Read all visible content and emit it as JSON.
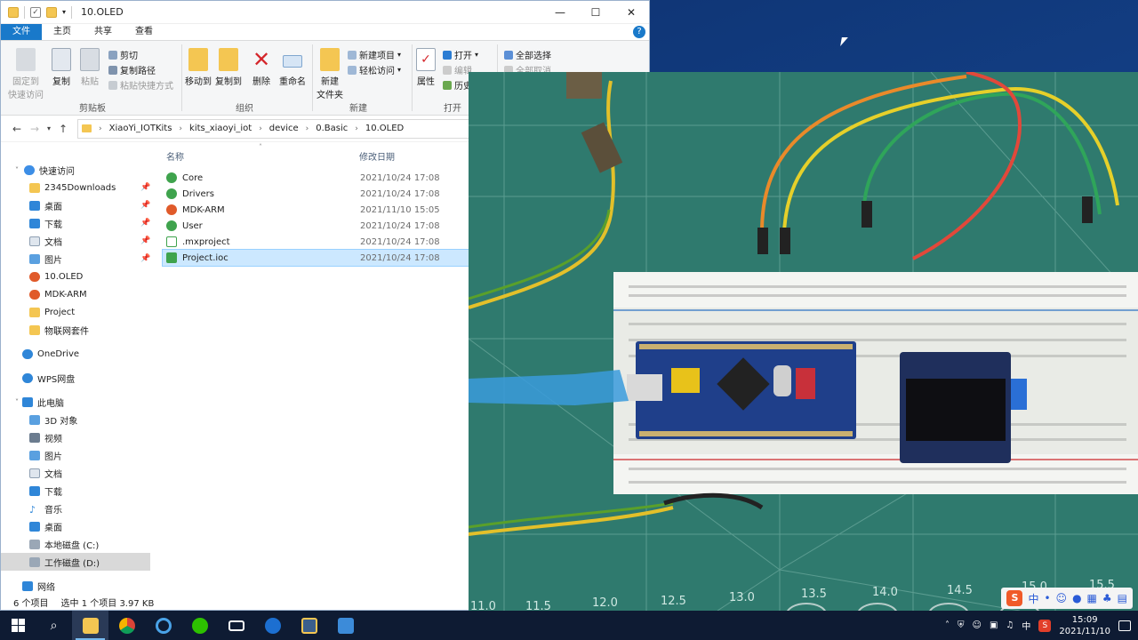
{
  "window": {
    "title": "10.OLED",
    "controls": [
      "—",
      "☐",
      "✕"
    ]
  },
  "ribbon_tabs": [
    "文件",
    "主页",
    "共享",
    "查看"
  ],
  "ribbon": {
    "pin_quick": "固定到\n快速访问",
    "copy": "复制",
    "paste": "粘贴",
    "cut": "剪切",
    "copy_path": "复制路径",
    "paste_shortcut": "粘贴快捷方式",
    "group_clipboard": "剪贴板",
    "move_to": "移动到",
    "copy_to": "复制到",
    "delete": "删除",
    "rename": "重命名",
    "group_organize": "组织",
    "new_folder": "新建\n文件夹",
    "new_item": "新建项目",
    "easy_access": "轻松访问",
    "group_new": "新建",
    "properties": "属性",
    "open": "打开",
    "edit": "编辑",
    "history": "历史",
    "group_open": "打开",
    "select_all": "全部选择",
    "select_none": "全部取消"
  },
  "breadcrumb": [
    "XiaoYi_IOTKits",
    "kits_xiaoyi_iot",
    "device",
    "0.Basic",
    "10.OLED"
  ],
  "nav_pane": {
    "quick_access": "快速访问",
    "quick_items": [
      {
        "label": "2345Downloads",
        "pinned": true
      },
      {
        "label": "桌面",
        "pinned": true
      },
      {
        "label": "下载",
        "pinned": true
      },
      {
        "label": "文档",
        "pinned": true
      },
      {
        "label": "图片",
        "pinned": true
      },
      {
        "label": "10.OLED",
        "pinned": false
      },
      {
        "label": "MDK-ARM",
        "pinned": false
      },
      {
        "label": "Project",
        "pinned": false
      },
      {
        "label": "物联网套件",
        "pinned": false
      }
    ],
    "onedrive": "OneDrive",
    "wps": "WPS网盘",
    "this_pc": "此电脑",
    "pc_items": [
      "3D 对象",
      "视频",
      "图片",
      "文档",
      "下载",
      "音乐",
      "桌面",
      "本地磁盘 (C:)",
      "工作磁盘 (D:)"
    ],
    "network": "网络"
  },
  "columns": {
    "name": "名称",
    "modified": "修改日期"
  },
  "files": [
    {
      "name": "Core",
      "date": "2021/10/24 17:08"
    },
    {
      "name": "Drivers",
      "date": "2021/10/24 17:08"
    },
    {
      "name": "MDK-ARM",
      "date": "2021/11/10 15:05"
    },
    {
      "name": "User",
      "date": "2021/10/24 17:08"
    },
    {
      "name": ".mxproject",
      "date": "2021/10/24 17:08"
    },
    {
      "name": "Project.ioc",
      "date": "2021/10/24 17:08"
    }
  ],
  "status": {
    "count": "6 个项目",
    "selected": "选中 1 个项目  3.97 KB"
  },
  "video": {
    "mat_labels": [
      "11.0",
      "11.5",
      "12.0",
      "12.5",
      "13.0",
      "13.5",
      "14.0",
      "14.5",
      "15.0",
      "15.5"
    ],
    "ime_text": "中"
  },
  "taskbar": {
    "time": "15:09",
    "date": "2021/11/10",
    "ime_lang": "中"
  },
  "colors": {
    "accent": "#1979ca",
    "selection": "#cce8ff",
    "mat_green": "#2f7a6e"
  }
}
